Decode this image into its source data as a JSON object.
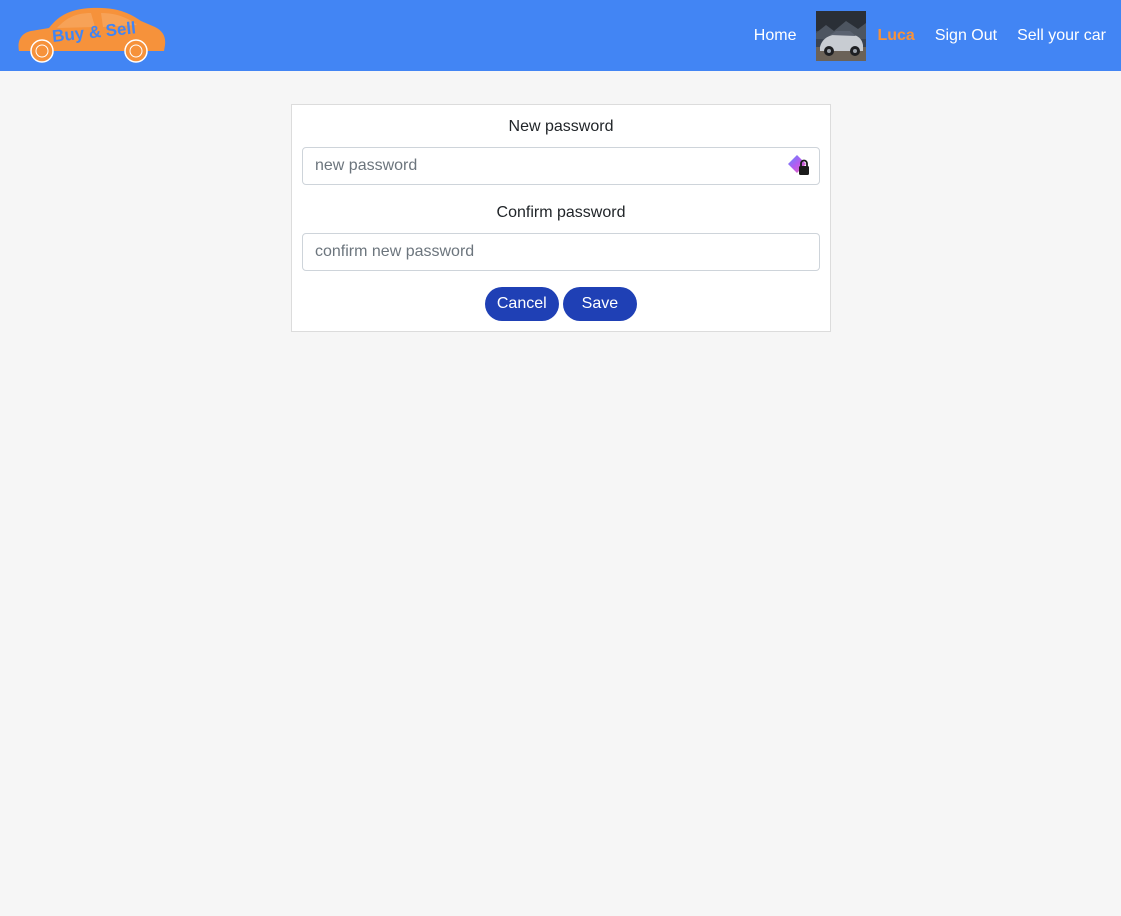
{
  "header": {
    "logo_text": "Buy & Sell",
    "nav": {
      "home": "Home",
      "user_name": "Luca",
      "sign_out": "Sign Out",
      "sell": "Sell your car"
    }
  },
  "form": {
    "new_password": {
      "label": "New password",
      "value": "",
      "placeholder": "new password"
    },
    "confirm_password": {
      "label": "Confirm password",
      "value": "",
      "placeholder": "confirm new password"
    },
    "cancel_label": "Cancel",
    "save_label": "Save"
  },
  "colors": {
    "navbar": "#4285f4",
    "logo_car": "#f6923b",
    "logo_text": "#4285f4",
    "user_name": "#f6923b",
    "button": "#1f40b5",
    "background": "#f6f6f6"
  },
  "icons": {
    "password_manager": "password-manager-icon",
    "avatar": "car-photo-avatar"
  }
}
